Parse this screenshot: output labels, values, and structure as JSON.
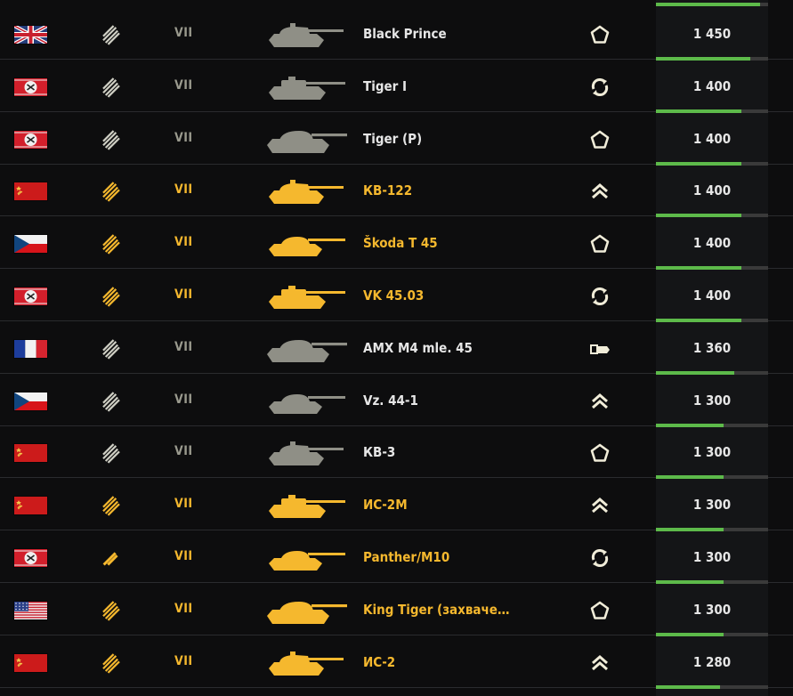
{
  "colors": {
    "premium": "#f5b82e",
    "regular": "#9a9a8e",
    "regular_name": "#e6e6e6",
    "progress": "#5dba4a",
    "progress_track": "#3a3a3a"
  },
  "top_bar": {
    "progress": 0.93
  },
  "rows": [
    {
      "nation": "uk",
      "rank": "double",
      "tier": "VII",
      "premium": false,
      "silhouette": "heavy-a",
      "name": "Black Prince",
      "class_icon": "pentagon-icon",
      "score": "1 450",
      "progress": 0.84
    },
    {
      "nation": "germany",
      "rank": "double",
      "tier": "VII",
      "premium": false,
      "silhouette": "heavy-b",
      "name": "Tiger I",
      "class_icon": "circle-arrows-icon",
      "score": "1 400",
      "progress": 0.76
    },
    {
      "nation": "germany",
      "rank": "double",
      "tier": "VII",
      "premium": false,
      "silhouette": "heavy-c",
      "name": "Tiger (P)",
      "class_icon": "pentagon-icon",
      "score": "1 400",
      "progress": 0.76
    },
    {
      "nation": "ussr",
      "rank": "double",
      "tier": "VII",
      "premium": true,
      "silhouette": "heavy-a",
      "name": "КВ-122",
      "class_icon": "double-chevron-icon",
      "score": "1 400",
      "progress": 0.76
    },
    {
      "nation": "czech",
      "rank": "double",
      "tier": "VII",
      "premium": true,
      "silhouette": "medium-a",
      "name": "Škoda T 45",
      "class_icon": "pentagon-icon",
      "score": "1 400",
      "progress": 0.76
    },
    {
      "nation": "germany",
      "rank": "double",
      "tier": "VII",
      "premium": true,
      "silhouette": "heavy-b",
      "name": "VK 45.03",
      "class_icon": "circle-arrows-icon",
      "score": "1 400",
      "progress": 0.76
    },
    {
      "nation": "france",
      "rank": "double",
      "tier": "VII",
      "premium": false,
      "silhouette": "heavy-c",
      "name": "AMX M4 mle. 45",
      "class_icon": "flag-shield-icon",
      "score": "1 360",
      "progress": 0.7
    },
    {
      "nation": "czech",
      "rank": "double",
      "tier": "VII",
      "premium": false,
      "silhouette": "medium-a",
      "name": "Vz. 44-1",
      "class_icon": "double-chevron-icon",
      "score": "1 300",
      "progress": 0.6
    },
    {
      "nation": "ussr",
      "rank": "double",
      "tier": "VII",
      "premium": false,
      "silhouette": "heavy-a",
      "name": "КВ-3",
      "class_icon": "pentagon-icon",
      "score": "1 300",
      "progress": 0.6
    },
    {
      "nation": "ussr",
      "rank": "double",
      "tier": "VII",
      "premium": true,
      "silhouette": "heavy-b",
      "name": "ИС-2М",
      "class_icon": "double-chevron-icon",
      "score": "1 300",
      "progress": 0.6
    },
    {
      "nation": "germany",
      "rank": "single",
      "tier": "VII",
      "premium": true,
      "silhouette": "medium-a",
      "name": "Panther/M10",
      "class_icon": "circle-arrows-icon",
      "score": "1 300",
      "progress": 0.6
    },
    {
      "nation": "usa",
      "rank": "double",
      "tier": "VII",
      "premium": true,
      "silhouette": "heavy-c",
      "name": "King Tiger (захваченн…",
      "class_icon": "pentagon-icon",
      "score": "1 300",
      "progress": 0.6
    },
    {
      "nation": "ussr",
      "rank": "double",
      "tier": "VII",
      "premium": true,
      "silhouette": "heavy-a",
      "name": "ИС-2",
      "class_icon": "double-chevron-icon",
      "score": "1 280",
      "progress": 0.57
    }
  ]
}
